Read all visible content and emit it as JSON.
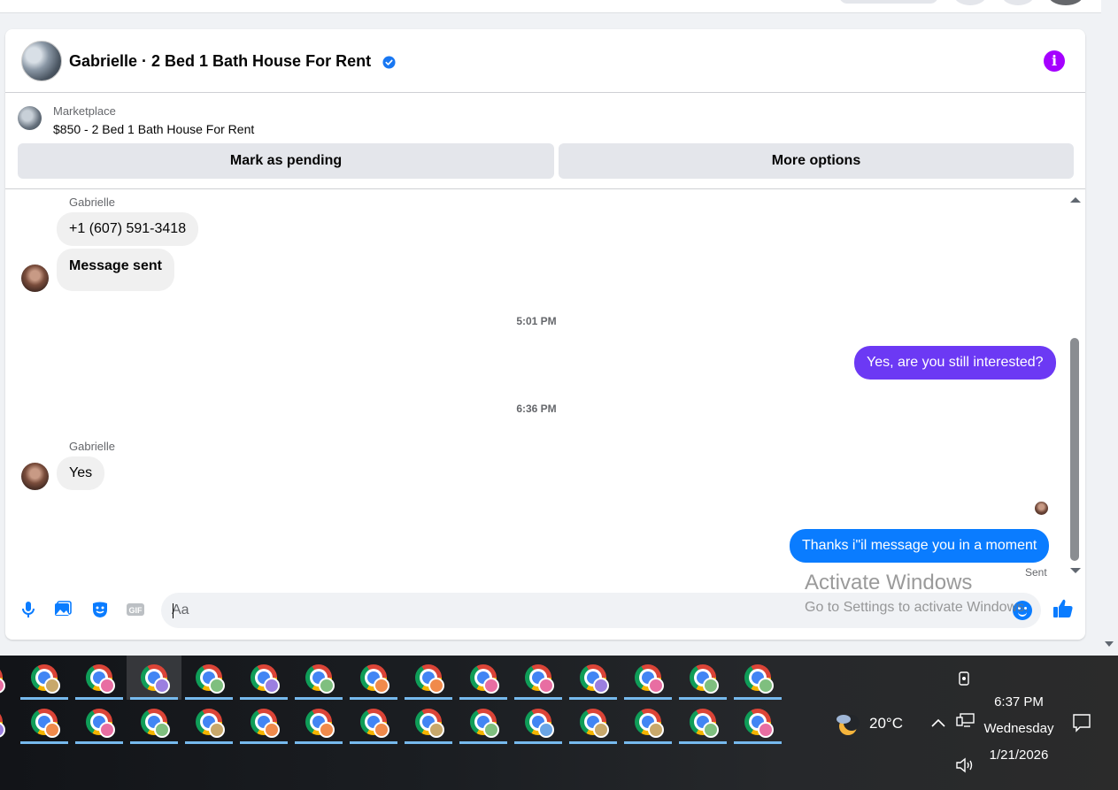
{
  "conversation": {
    "title": "Gabrielle · 2 Bed 1 Bath House For Rent",
    "verified_icon": "verified-badge-icon",
    "info_icon": "info-icon",
    "accent_color": "#a500ff"
  },
  "marketplace": {
    "label": "Marketplace",
    "listing": "$850 - 2 Bed 1 Bath House For Rent",
    "mark_pending": "Mark as pending",
    "more_options": "More options"
  },
  "messages": {
    "m1_sender": "Gabrielle",
    "m1_text": "+1 (607) 591-3418",
    "m2_text": "Message sent",
    "ts1": "5:01 PM",
    "m3_text": "Yes, are you still interested?",
    "ts2": "6:36 PM",
    "m4_sender": "Gabrielle",
    "m4_text": "Yes",
    "m5_text": "Thanks i\"il message you in a moment",
    "m5_status": "Sent",
    "outgoing_purple": "#6c39f4",
    "outgoing_blue": "#0a7cff"
  },
  "composer": {
    "placeholder": "Aa",
    "icons": [
      "microphone-icon",
      "photo-icon",
      "sticker-icon",
      "gif-icon",
      "emoji-icon",
      "thumbs-up-icon"
    ]
  },
  "watermark": {
    "line1": "Activate Windows",
    "line2": "Go to Settings to activate Windows."
  },
  "taskbar": {
    "weather_temp": "20°C",
    "weather_icon": "moon-cloud-icon",
    "time": "6:37 PM",
    "day": "Wednesday",
    "date": "1/21/2026",
    "app_icon": "chrome-icon"
  }
}
